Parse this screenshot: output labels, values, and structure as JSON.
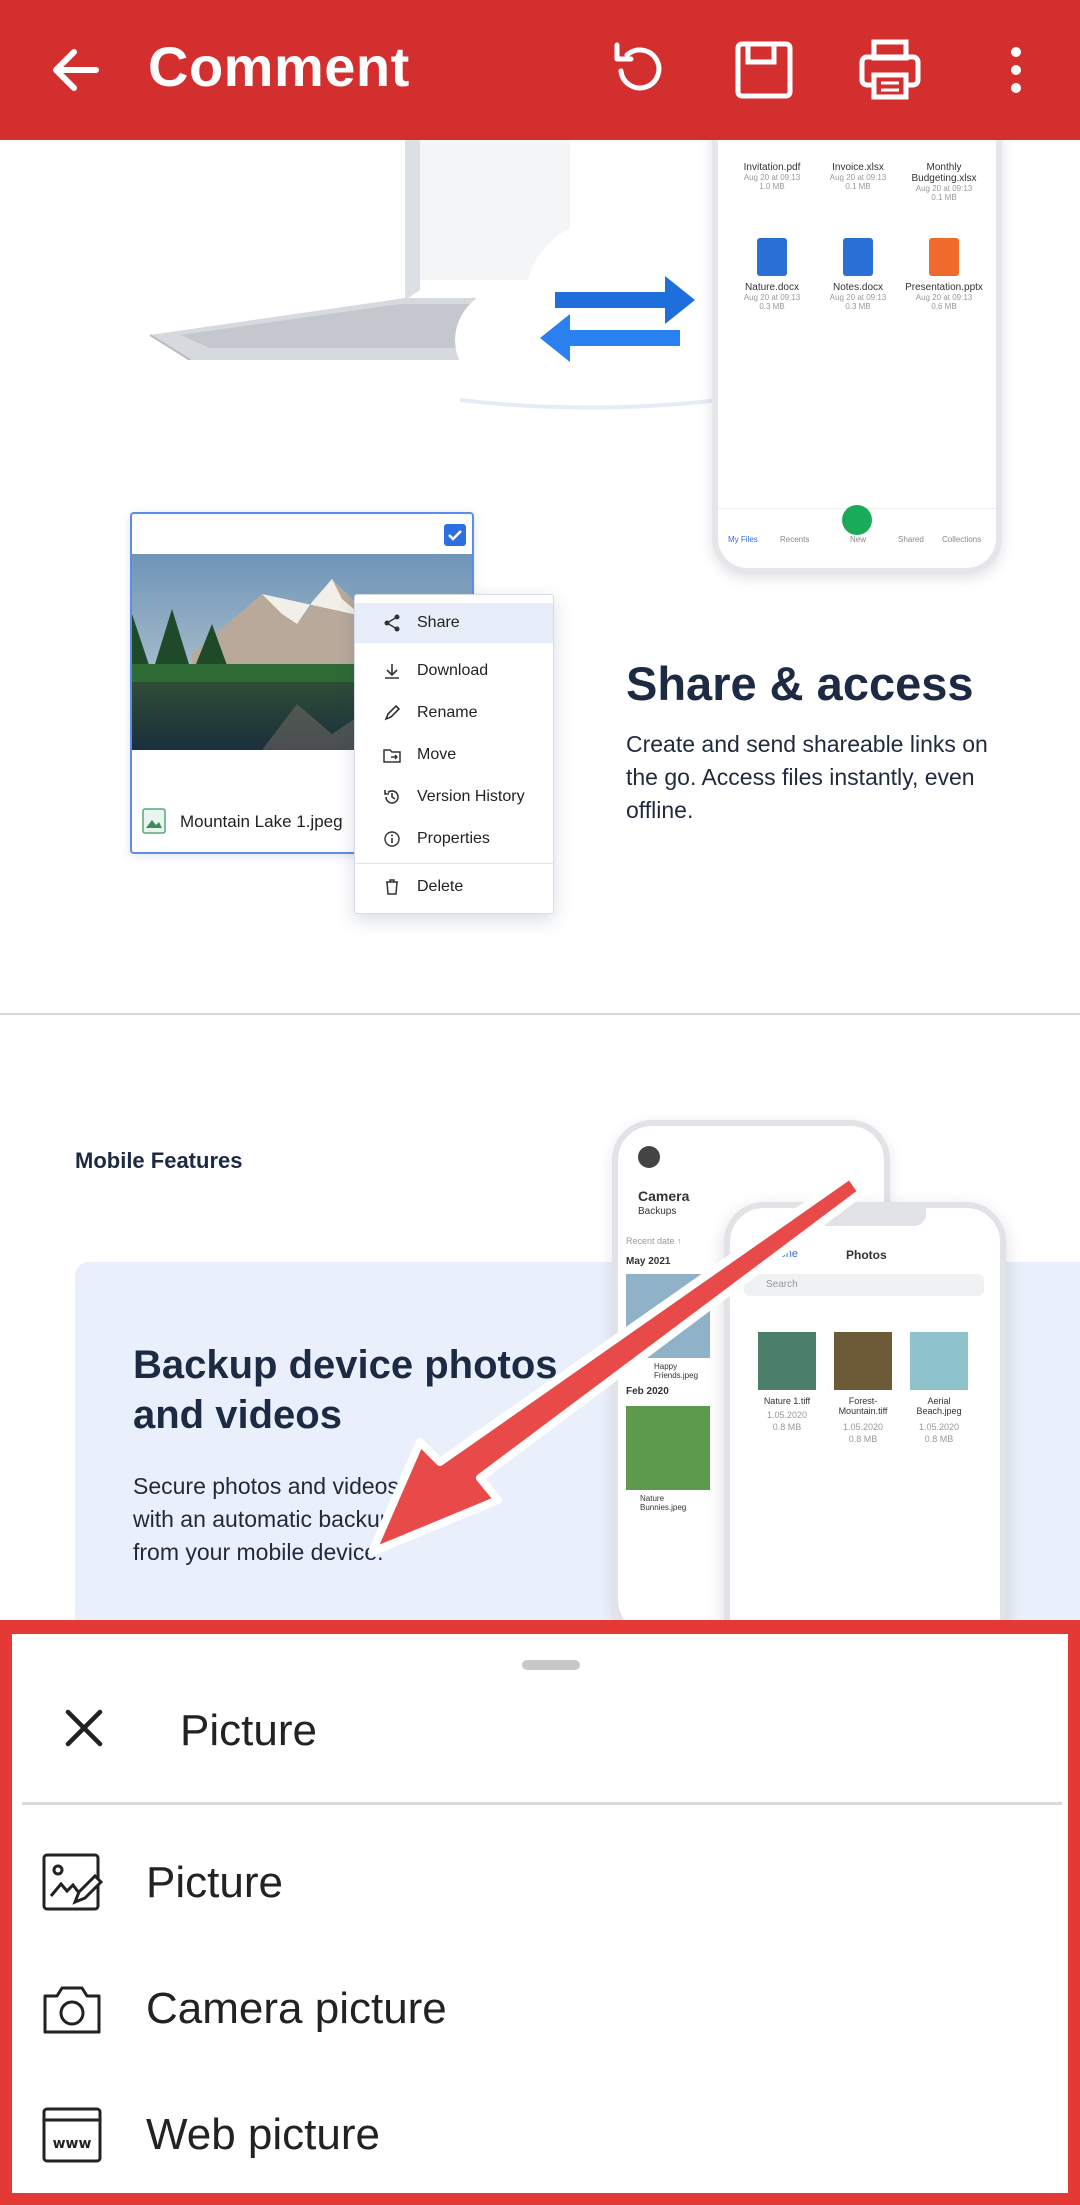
{
  "appbar": {
    "title": "Comment",
    "icons": [
      "back-arrow-icon",
      "undo-icon",
      "save-icon",
      "print-icon",
      "more-vert-icon"
    ],
    "color": "#d32f2f"
  },
  "content": {
    "phone_top": {
      "files": [
        {
          "name": "Invitation.pdf",
          "meta1": "Aug 20 at 09:13",
          "meta2": "1.0 MB"
        },
        {
          "name": "Invoice.xlsx",
          "meta1": "Aug 20 at 09:13",
          "meta2": "0.1 MB"
        },
        {
          "name": "Monthly Budgeting.xlsx",
          "meta1": "Aug 20 at 09:13",
          "meta2": "0.1 MB"
        },
        {
          "name": "Nature.docx",
          "meta1": "Aug 20 at 09:13",
          "meta2": "0.3 MB"
        },
        {
          "name": "Notes.docx",
          "meta1": "Aug 20 at 09:13",
          "meta2": "0.3 MB"
        },
        {
          "name": "Presentation.pptx",
          "meta1": "Aug 20 at 09:13",
          "meta2": "0.6 MB"
        }
      ],
      "nav": [
        "My Files",
        "Recents",
        "New",
        "Shared",
        "Collections"
      ]
    },
    "file_card": {
      "filename": "Mountain Lake 1.jpeg"
    },
    "context_menu": {
      "items": [
        "Share",
        "Download",
        "Rename",
        "Move",
        "Version History",
        "Properties",
        "Delete"
      ]
    },
    "share": {
      "title": "Share & access",
      "description": "Create and send shareable links on the go. Access files instantly, even offline."
    },
    "mobile": {
      "section_label": "Mobile Features",
      "title": "Backup device photos and videos",
      "description": "Secure photos and videos with an automatic backup from your mobile device.",
      "phone_back": {
        "title": "Camera",
        "subtitle": "Backups",
        "recent": "Recent date ↑",
        "month1": "May 2021",
        "month2": "Feb 2020",
        "file1": "Happy Friends.jpeg",
        "file2": "Nature Bunnies.jpeg"
      },
      "phone_front": {
        "back_label": "My iPhone",
        "title": "Photos",
        "search": "Search",
        "photos": [
          {
            "name": "Nature 1.tiff",
            "date": "1.05.2020",
            "size": "0.8 MB"
          },
          {
            "name": "Forest-Mountain.tiff",
            "date": "1.05.2020",
            "size": "0.8 MB"
          },
          {
            "name": "Aerial Beach.jpeg",
            "date": "1.05.2020",
            "size": "0.8 MB"
          }
        ]
      }
    }
  },
  "sheet": {
    "title": "Picture",
    "options": [
      {
        "label": "Picture",
        "icon": "image-edit-icon"
      },
      {
        "label": "Camera picture",
        "icon": "camera-icon"
      },
      {
        "label": "Web picture",
        "icon": "web-icon"
      }
    ],
    "border_color": "#e53935"
  }
}
